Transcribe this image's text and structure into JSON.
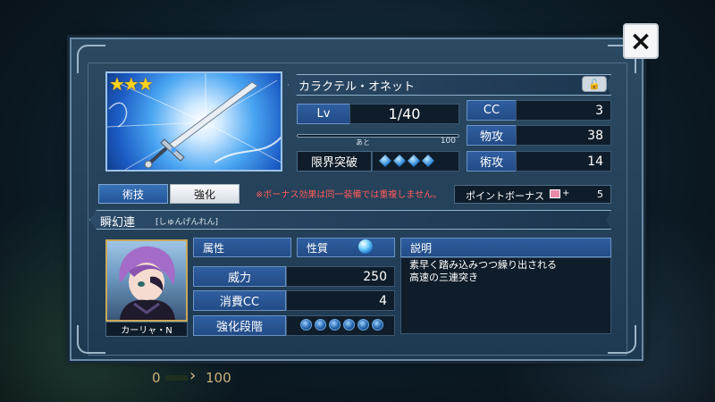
{
  "background": {
    "progress_start": "0",
    "progress_end": "100"
  },
  "close_label": "×",
  "weapon": {
    "rarity_stars": 3,
    "icon": "sword-icon"
  },
  "item": {
    "name": "カラクテル・オネット",
    "lock_icon": "lock-icon"
  },
  "stats": {
    "lv_label": "Lv",
    "lv_value": "1/40",
    "exp_prefix": "あと",
    "exp_value": "100",
    "limit_break_label": "限界突破",
    "limit_break_gems": 4,
    "cc_label": "CC",
    "cc_value": "3",
    "phys_label": "物攻",
    "phys_value": "38",
    "arte_label": "術攻",
    "arte_value": "14"
  },
  "tabs": [
    {
      "label": "術技",
      "active": true
    },
    {
      "label": "強化",
      "active": false
    }
  ],
  "note": "※ボーナス効果は同一装備では重複しません。",
  "bonus": {
    "label": "ポイントボーナス",
    "plus": "+",
    "value": "5"
  },
  "skill": {
    "name": "瞬幻連",
    "reading": "[しゅんげんれん]",
    "character_name": "カーリャ・N",
    "attribute_label": "属性",
    "nature_label": "性質",
    "power_label": "威力",
    "power_value": "250",
    "cc_cost_label": "消費CC",
    "cc_cost_value": "4",
    "stage_label": "強化段階",
    "stage_dots": 6,
    "desc_label": "説明",
    "desc_line1": "素早く踏み込みつつ繰り出される",
    "desc_line2": "高速の三連突き"
  },
  "colors": {
    "accent": "#2f5ea0",
    "note": "#ff5a5a",
    "stars": "#ffd21e"
  }
}
